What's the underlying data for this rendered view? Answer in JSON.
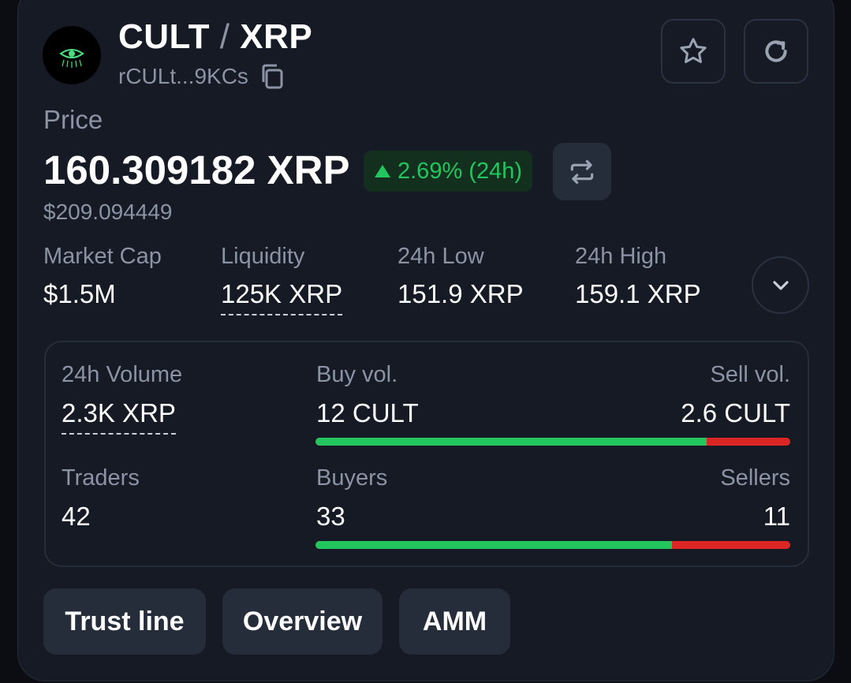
{
  "header": {
    "base_symbol": "CULT",
    "separator": "/",
    "quote_symbol": "XRP",
    "address": "rCULt...9KCs"
  },
  "price": {
    "label": "Price",
    "value": "160.309182 XRP",
    "change": "2.69% (24h)",
    "usd": "$209.094449"
  },
  "stats": [
    {
      "label": "Market Cap",
      "value": "$1.5M"
    },
    {
      "label": "Liquidity",
      "value": "125K XRP"
    },
    {
      "label": "24h Low",
      "value": "151.9 XRP"
    },
    {
      "label": "24h High",
      "value": "159.1 XRP"
    }
  ],
  "volume": {
    "volume_label": "24h Volume",
    "volume_value": "2.3K XRP",
    "buy_label": "Buy vol.",
    "buy_value": "12 CULT",
    "sell_label": "Sell vol.",
    "sell_value": "2.6 CULT",
    "buy_fraction": 0.824,
    "traders_label": "Traders",
    "traders_value": "42",
    "buyers_label": "Buyers",
    "buyers_value": "33",
    "sellers_label": "Sellers",
    "sellers_value": "11",
    "buyers_fraction": 0.75
  },
  "tabs": [
    "Trust line",
    "Overview",
    "AMM"
  ],
  "icons": {
    "logo": "eye-logo-icon",
    "copy": "copy-icon",
    "favorite": "star-icon",
    "refresh": "refresh-icon",
    "change_up": "triangle-up-icon",
    "swap": "swap-arrows-icon",
    "expand": "chevron-down-icon"
  },
  "colors": {
    "background": "#151a25",
    "positive": "#22c55e",
    "negative": "#dc2626",
    "muted": "#8b93a4",
    "button": "#262d3a"
  }
}
